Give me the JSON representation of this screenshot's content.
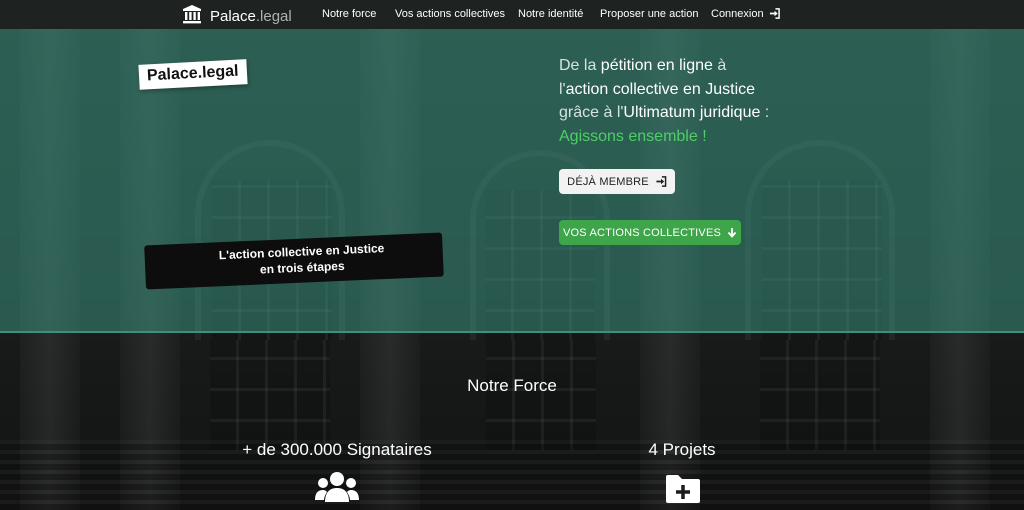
{
  "nav": {
    "brand": {
      "name": "Palace",
      "tld": ".legal"
    },
    "links": [
      "Notre force",
      "Vos actions collectives",
      "Notre identité",
      "Proposer une action",
      "Connexion"
    ]
  },
  "hero": {
    "sticker": "Palace.legal",
    "banner_line1": "L'action collective en Justice",
    "banner_line2": "en trois étapes",
    "headline": {
      "t1": "De la ",
      "b1": "pétition en ligne",
      "t2": " à",
      "t3": "l'",
      "b2": "action collective en Justice",
      "t4": "grâce à l'",
      "b3": "Ultimatum juridique",
      "t5": " :",
      "cta": "Agissons ensemble !"
    },
    "btn_member": "DÉJÀ MEMBRE",
    "btn_actions": "VOS ACTIONS COLLECTIVES"
  },
  "force": {
    "title": "Notre Force",
    "stat1": "+ de 300.000 Signataires",
    "stat2": "4 Projets"
  },
  "colors": {
    "accent_green": "#3fa54a",
    "cta_text": "#4cd064",
    "teal_overlay": "#2e6e60"
  },
  "icons": [
    "landmark-icon",
    "sign-in-icon",
    "arrow-down-icon",
    "users-icon",
    "folder-plus-icon"
  ]
}
